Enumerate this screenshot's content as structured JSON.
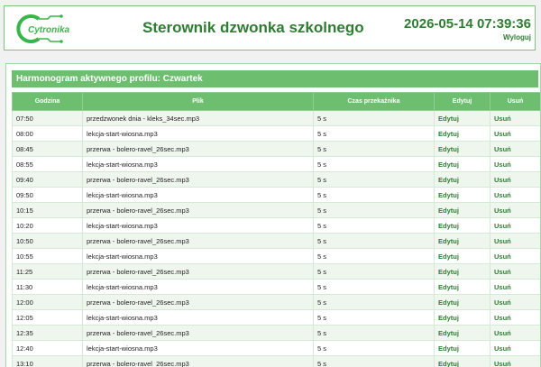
{
  "header": {
    "logo_text": "Cytronika",
    "title": "Sterownik dzwonka szkolnego",
    "datetime": "2026-05-14 07:39:36",
    "logout": "Wyloguj"
  },
  "panel": {
    "title": "Harmonogram aktywnego profilu: Czwartek"
  },
  "table": {
    "headers": [
      "Godzina",
      "Plik",
      "Czas przekaźnika",
      "Edytuj",
      "Usuń"
    ],
    "rows": [
      {
        "time": "07:50",
        "file": "przedzwonek dnia - kleks_34sec.mp3",
        "relay": "5 s",
        "edit": "Edytuj",
        "delete": "Usuń"
      },
      {
        "time": "08:00",
        "file": "lekcja-start-wiosna.mp3",
        "relay": "5 s",
        "edit": "Edytuj",
        "delete": "Usuń"
      },
      {
        "time": "08:45",
        "file": "przerwa - bolero-ravel_26sec.mp3",
        "relay": "5 s",
        "edit": "Edytuj",
        "delete": "Usuń"
      },
      {
        "time": "08:55",
        "file": "lekcja-start-wiosna.mp3",
        "relay": "5 s",
        "edit": "Edytuj",
        "delete": "Usuń"
      },
      {
        "time": "09:40",
        "file": "przerwa - bolero-ravel_26sec.mp3",
        "relay": "5 s",
        "edit": "Edytuj",
        "delete": "Usuń"
      },
      {
        "time": "09:50",
        "file": "lekcja-start-wiosna.mp3",
        "relay": "5 s",
        "edit": "Edytuj",
        "delete": "Usuń"
      },
      {
        "time": "10:15",
        "file": "przerwa - bolero-ravel_26sec.mp3",
        "relay": "5 s",
        "edit": "Edytuj",
        "delete": "Usuń"
      },
      {
        "time": "10:20",
        "file": "lekcja-start-wiosna.mp3",
        "relay": "5 s",
        "edit": "Edytuj",
        "delete": "Usuń"
      },
      {
        "time": "10:50",
        "file": "przerwa - bolero-ravel_26sec.mp3",
        "relay": "5 s",
        "edit": "Edytuj",
        "delete": "Usuń"
      },
      {
        "time": "10:55",
        "file": "lekcja-start-wiosna.mp3",
        "relay": "5 s",
        "edit": "Edytuj",
        "delete": "Usuń"
      },
      {
        "time": "11:25",
        "file": "przerwa - bolero-ravel_26sec.mp3",
        "relay": "5 s",
        "edit": "Edytuj",
        "delete": "Usuń"
      },
      {
        "time": "11:30",
        "file": "lekcja-start-wiosna.mp3",
        "relay": "5 s",
        "edit": "Edytuj",
        "delete": "Usuń"
      },
      {
        "time": "12:00",
        "file": "przerwa - bolero-ravel_26sec.mp3",
        "relay": "5 s",
        "edit": "Edytuj",
        "delete": "Usuń"
      },
      {
        "time": "12:05",
        "file": "lekcja-start-wiosna.mp3",
        "relay": "5 s",
        "edit": "Edytuj",
        "delete": "Usuń"
      },
      {
        "time": "12:35",
        "file": "przerwa - bolero-ravel_26sec.mp3",
        "relay": "5 s",
        "edit": "Edytuj",
        "delete": "Usuń"
      },
      {
        "time": "12:40",
        "file": "lekcja-start-wiosna.mp3",
        "relay": "5 s",
        "edit": "Edytuj",
        "delete": "Usuń"
      },
      {
        "time": "13:10",
        "file": "przerwa - bolero-ravel_26sec.mp3",
        "relay": "5 s",
        "edit": "Edytuj",
        "delete": "Usuń"
      }
    ]
  },
  "colors": {
    "accent": "#2e7d32",
    "header_bar": "#6dbf6f",
    "row_alt": "#eef6ee",
    "logo_green": "#39b54a"
  },
  "icons": {
    "logo": "cytronika-logo"
  }
}
